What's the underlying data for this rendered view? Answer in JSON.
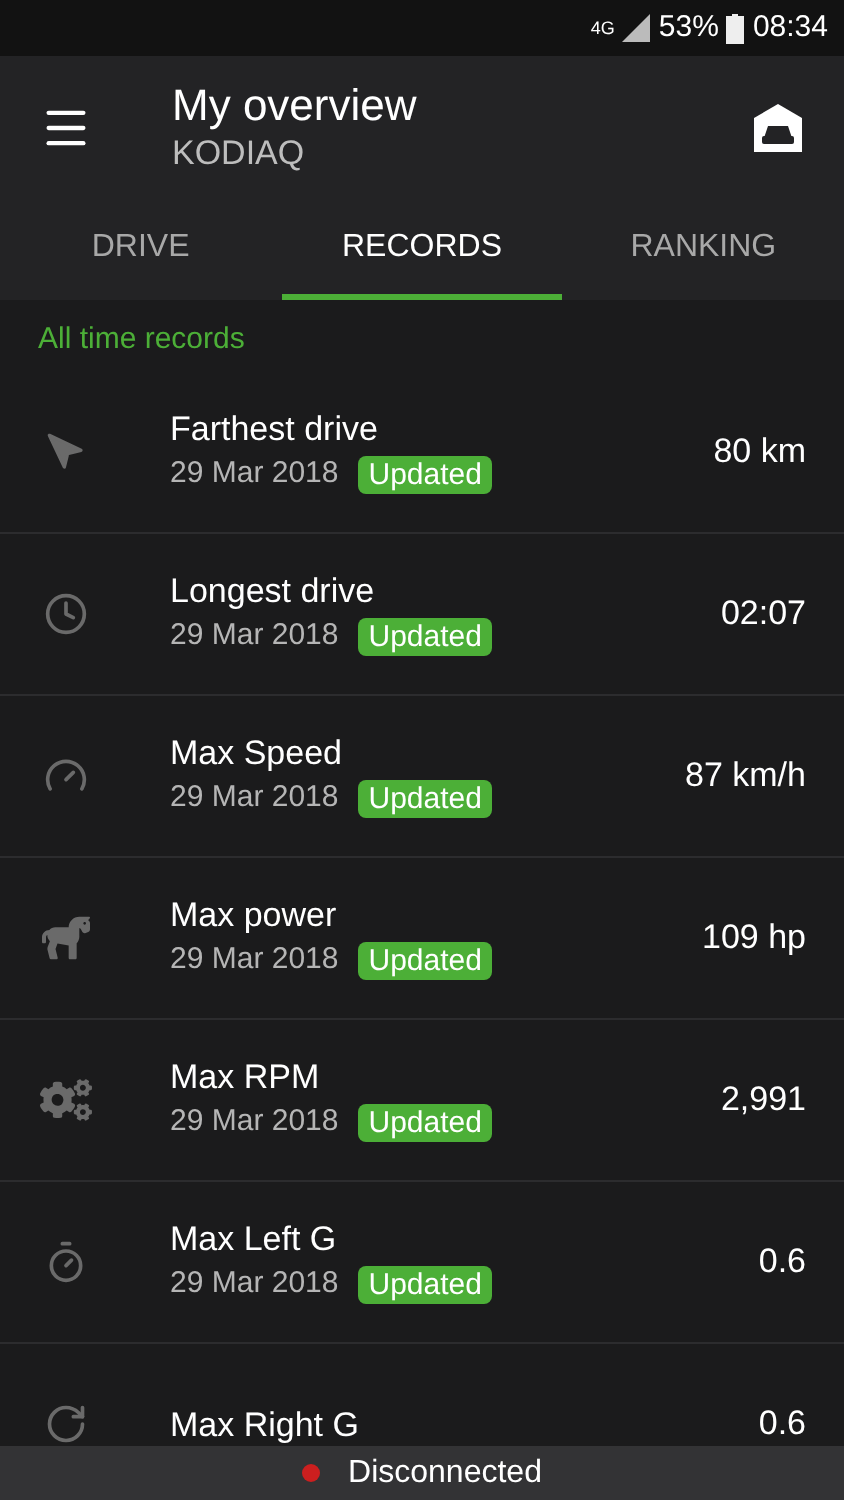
{
  "status_bar": {
    "network": "4G",
    "battery": "53%",
    "time": "08:34"
  },
  "header": {
    "title": "My overview",
    "subtitle": "KODIAQ"
  },
  "tabs": [
    {
      "label": "DRIVE",
      "selected": false
    },
    {
      "label": "RECORDS",
      "selected": true
    },
    {
      "label": "RANKING",
      "selected": false
    }
  ],
  "section_title": "All time records",
  "records": [
    {
      "kind": "distance",
      "name": "Farthest drive",
      "date": "29 Mar 2018",
      "badge": "Updated",
      "value": "80 km"
    },
    {
      "kind": "duration",
      "name": "Longest drive",
      "date": "29 Mar 2018",
      "badge": "Updated",
      "value": "02:07"
    },
    {
      "kind": "speed",
      "name": "Max Speed",
      "date": "29 Mar 2018",
      "badge": "Updated",
      "value": "87 km/h"
    },
    {
      "kind": "power",
      "name": "Max power",
      "date": "29 Mar 2018",
      "badge": "Updated",
      "value": "109 hp"
    },
    {
      "kind": "rpm",
      "name": "Max RPM",
      "date": "29 Mar 2018",
      "badge": "Updated",
      "value": "2,991"
    },
    {
      "kind": "left_g",
      "name": "Max Left G",
      "date": "29 Mar 2018",
      "badge": "Updated",
      "value": "0.6"
    },
    {
      "kind": "right_g",
      "name": "Max Right G",
      "value": "0.6"
    }
  ],
  "connection": {
    "label": "Disconnected",
    "color": "#cc1f1f"
  }
}
